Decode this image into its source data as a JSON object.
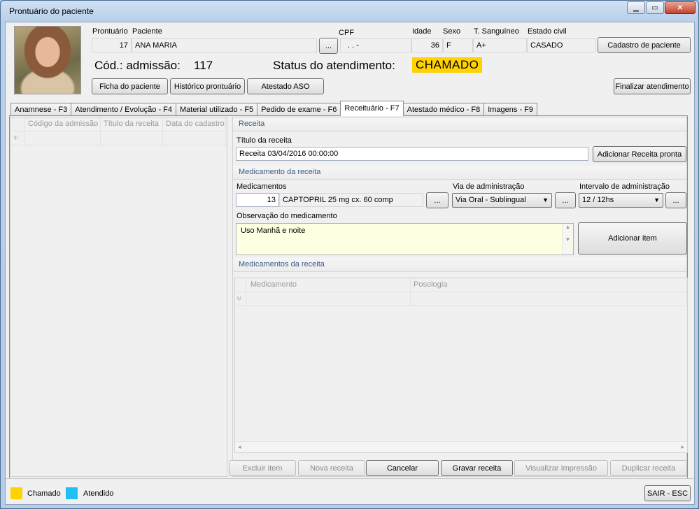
{
  "window": {
    "title": "Prontuário do paciente"
  },
  "header": {
    "labels": {
      "prontuario": "Prontuário",
      "paciente": "Paciente",
      "cpf": "CPF",
      "idade": "Idade",
      "sexo": "Sexo",
      "tipo_sanguineo": "T. Sanguíneo",
      "estado_civil": "Estado civil"
    },
    "values": {
      "prontuario": "17",
      "paciente": "ANA MARIA",
      "cpf": ".   .   -",
      "idade": "36",
      "sexo": "F",
      "tipo_sanguineo": "A+",
      "estado_civil": "CASADO"
    },
    "cpf_lookup_button": "...",
    "cadastro_button": "Cadastro de paciente",
    "admissao_label": "Cód.: admissão:",
    "admissao_value": "117",
    "status_label": "Status do atendimento:",
    "status_value": "CHAMADO",
    "status_color": "#ffd200",
    "buttons": {
      "ficha": "Ficha do paciente",
      "historico": "Histórico prontuário",
      "atestado_aso": "Atestado ASO",
      "finalizar": "Finalizar atendimento"
    }
  },
  "tabs": [
    {
      "label": "Anamnese - F3",
      "active": false
    },
    {
      "label": "Atendimento / Evolução - F4",
      "active": false
    },
    {
      "label": "Material utilizado - F5",
      "active": false
    },
    {
      "label": "Pedido de exame - F6",
      "active": false
    },
    {
      "label": "Receituário - F7",
      "active": true
    },
    {
      "label": "Atestado médico - F8",
      "active": false
    },
    {
      "label": "Imagens - F9",
      "active": false
    }
  ],
  "left_grid": {
    "columns": [
      "Código da admissão",
      "Título da receita",
      "Data do cadastro"
    ],
    "rows": []
  },
  "receita": {
    "section_title": "Receita",
    "titulo_label": "Título da receita",
    "titulo_value": "Receita 03/04/2016 00:00:00",
    "add_pronta_button": "Adicionar Receita pronta"
  },
  "medicamento": {
    "section_title": "Medicamento da receita",
    "medicamentos_label": "Medicamentos",
    "medicamento_code": "13",
    "medicamento_name": "CAPTOPRIL 25 mg cx. 60 comp",
    "lookup_button": "...",
    "via_label": "Via de administração",
    "via_value": "Via Oral - Sublingual",
    "intervalo_label": "Intervalo de administração",
    "intervalo_value": "12 / 12hs",
    "observacao_label": "Observação do medicamento",
    "observacao_value": "Uso Manhã e noite",
    "add_item_button": "Adicionar item"
  },
  "medicamentos_receita": {
    "section_title": "Medicamentos da receita",
    "columns": [
      "Medicamento",
      "Posologia"
    ],
    "rows": []
  },
  "bottom_buttons": {
    "excluir": "Excluir item",
    "nova": "Nova receita",
    "cancelar": "Cancelar",
    "gravar": "Gravar receita",
    "visualizar": "Visualizar Impressão",
    "duplicar": "Duplicar receita"
  },
  "legend": [
    {
      "label": "Chamado",
      "color": "#ffd200"
    },
    {
      "label": "Atendido",
      "color": "#1ec0f5"
    }
  ],
  "sair_button": "SAIR - ESC"
}
